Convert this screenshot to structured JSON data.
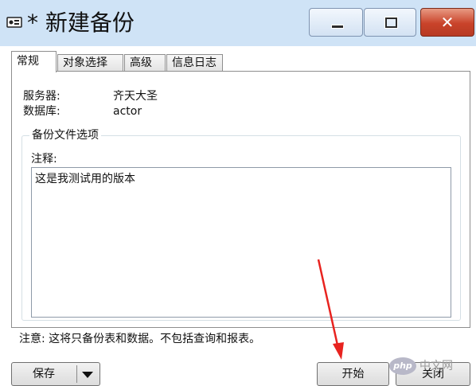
{
  "window": {
    "title": "* 新建备份",
    "close_glyph": "✕",
    "icon": "database-backup-icon"
  },
  "tabs": [
    {
      "label": "常规",
      "active": true
    },
    {
      "label": "对象选择",
      "active": false
    },
    {
      "label": "高级",
      "active": false
    },
    {
      "label": "信息日志",
      "active": false
    }
  ],
  "general": {
    "server_label": "服务器:",
    "server_value": "齐天大圣",
    "database_label": "数据库:",
    "database_value": "actor",
    "group_title": "备份文件选项",
    "remark_label": "注释:",
    "remark_value": "这是我测试用的版本"
  },
  "note": "注意: 这将只备份表和数据。不包括查询和报表。",
  "buttons": {
    "save": "保存",
    "start": "开始",
    "close": "关闭"
  },
  "watermark": {
    "badge": "php",
    "text": "中文网"
  },
  "colors": {
    "titlebar": "#cfe3f6",
    "close_button": "#c9432a",
    "annotation_arrow": "#e8231f"
  }
}
